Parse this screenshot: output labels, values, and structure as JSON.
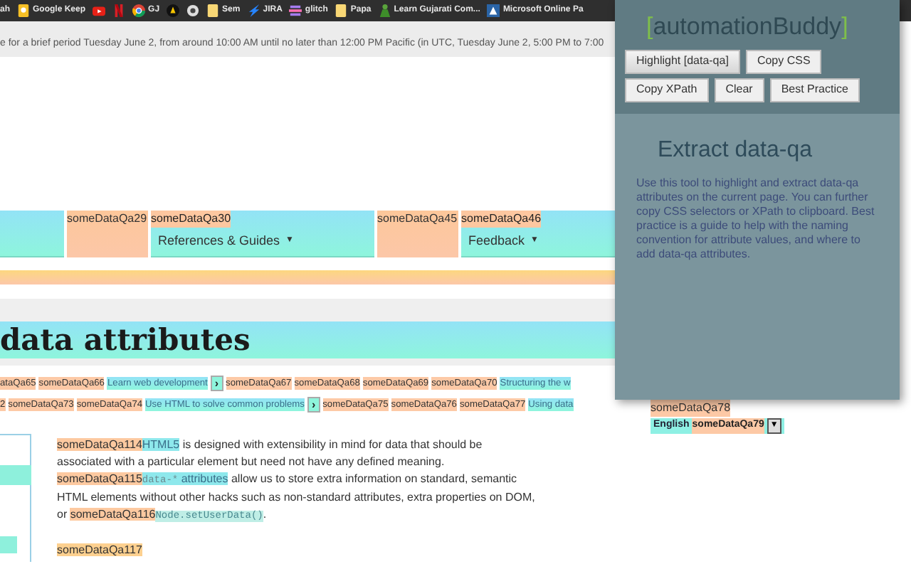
{
  "bookmarks": [
    {
      "kind": "link",
      "label": "ah"
    },
    {
      "kind": "link",
      "label": "Google Keep"
    },
    {
      "kind": "icon"
    },
    {
      "kind": "icon"
    },
    {
      "kind": "link",
      "label": "GJ"
    },
    {
      "kind": "icon"
    },
    {
      "kind": "icon"
    },
    {
      "kind": "link",
      "label": "Sem"
    },
    {
      "kind": "link",
      "label": "JIRA"
    },
    {
      "kind": "link",
      "label": "glitch"
    },
    {
      "kind": "link",
      "label": "Papa"
    },
    {
      "kind": "link",
      "label": "Learn Gujarati Com..."
    },
    {
      "kind": "link",
      "label": "Microsoft Online Pa"
    }
  ],
  "notice": "e for a brief period Tuesday June 2, from around 10:00 AM until no later than 12:00 PM Pacific (in UTC, Tuesday June 2, 5:00 PM to 7:00",
  "nav": [
    {
      "kind": "blank"
    },
    {
      "kind": "tag",
      "tag": "someDataQa29"
    },
    {
      "kind": "menu",
      "tag": "someDataQa30",
      "label": "References & Guides",
      "caret": "▼"
    },
    {
      "kind": "tag",
      "tag": "someDataQa45"
    },
    {
      "kind": "menu",
      "tag": "someDataQa46",
      "label": "Feedback",
      "caret": "▼"
    }
  ],
  "heading": "data attributes",
  "tag_rows": [
    [
      {
        "kind": "tag",
        "text": "ataQa65"
      },
      {
        "kind": "tag",
        "text": "someDataQa66"
      },
      {
        "kind": "link",
        "text": "Learn web development"
      },
      {
        "kind": "arrow",
        "text": "›"
      },
      {
        "kind": "tag",
        "text": "someDataQa67"
      },
      {
        "kind": "tag",
        "text": "someDataQa68"
      },
      {
        "kind": "tag",
        "text": "someDataQa69"
      },
      {
        "kind": "tag",
        "text": "someDataQa70"
      },
      {
        "kind": "link",
        "text": "Structuring the w"
      }
    ],
    [
      {
        "kind": "tag",
        "text": "2"
      },
      {
        "kind": "tag",
        "text": "someDataQa73"
      },
      {
        "kind": "tag",
        "text": "someDataQa74"
      },
      {
        "kind": "link",
        "text": "Use HTML to solve common problems"
      },
      {
        "kind": "arrow",
        "text": "›"
      },
      {
        "kind": "tag",
        "text": "someDataQa75"
      },
      {
        "kind": "tag",
        "text": "someDataQa76"
      },
      {
        "kind": "tag",
        "text": "someDataQa77"
      },
      {
        "kind": "link",
        "text": "Using data"
      }
    ]
  ],
  "aside": {
    "tag": "someDataQa78",
    "language": "English",
    "language_tag": "someDataQa79",
    "caret": "▼"
  },
  "paragraph": [
    {
      "kind": "tag",
      "text": "someDataQa114"
    },
    {
      "kind": "link",
      "text": "HTML5"
    },
    {
      "kind": "text",
      "text": " is designed with extensibility in mind for data that should be associated with a particular element but need not have any defined meaning. "
    },
    {
      "kind": "tag",
      "text": "someDataQa115"
    },
    {
      "kind": "code_link",
      "code": "data-*",
      "text": "attributes"
    },
    {
      "kind": "text",
      "text": " allow us to store extra information on standard, semantic HTML elements without other hacks such as non-standard attributes, extra properties on DOM, or "
    },
    {
      "kind": "tag",
      "text": "someDataQa116"
    },
    {
      "kind": "code",
      "text": "Node.setUserData()"
    },
    {
      "kind": "text",
      "text": "."
    }
  ],
  "footer_tag": "someDataQa117",
  "panel": {
    "title_open": "[",
    "title": "automationBuddy",
    "title_close": "]",
    "buttons": [
      {
        "label": "Highlight [data-qa]",
        "pressed": true
      },
      {
        "label": "Copy CSS",
        "pressed": false
      },
      {
        "label": "Copy XPath",
        "pressed": false
      },
      {
        "label": "Clear",
        "pressed": false
      },
      {
        "label": "Best Practice",
        "pressed": false
      }
    ],
    "heading": "Extract data-qa",
    "description": "Use this tool to highlight and extract data-qa attributes on the current page. You can further copy CSS selectors or XPath to clipboard. Best practice is a guide to help with the naming convention for attribute values, and where to add data-qa attributes."
  }
}
